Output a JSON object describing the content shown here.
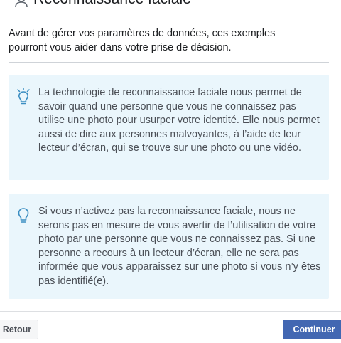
{
  "header": {
    "title": "Reconnaissance faciale",
    "icon": "face-recognition-icon"
  },
  "intro": {
    "text": "Avant de gérer vos paramètres de données, ces exemples pourront vous aider dans votre prise de décision."
  },
  "cards": [
    {
      "icon": "lightbulb-glowing-icon",
      "text": "La technologie de reconnaissance faciale nous permet de savoir quand une personne que vous ne connaissez pas utilise une photo pour usurper votre identité. Elle nous permet aussi de dire aux personnes malvoyantes, à l’aide de leur lecteur d’écran, qui se trouve sur une photo ou une vidéo."
    },
    {
      "icon": "lightbulb-icon",
      "text": "Si vous n’activez pas la reconnaissance faciale, nous ne serons pas en mesure de vous avertir de l’utilisation de votre photo par une personne que vous ne connaissez pas. Si une personne a recours à un lecteur d’écran, elle ne sera pas informée que vous apparaissez sur une photo si vous n’y êtes pas identifié(e)."
    }
  ],
  "footer": {
    "back_label": "Retour",
    "continue_label": "Continuer"
  },
  "colors": {
    "card_background": "#eaf6fc",
    "accent": "#4267b2",
    "icon_blue": "#3b8ec2"
  }
}
